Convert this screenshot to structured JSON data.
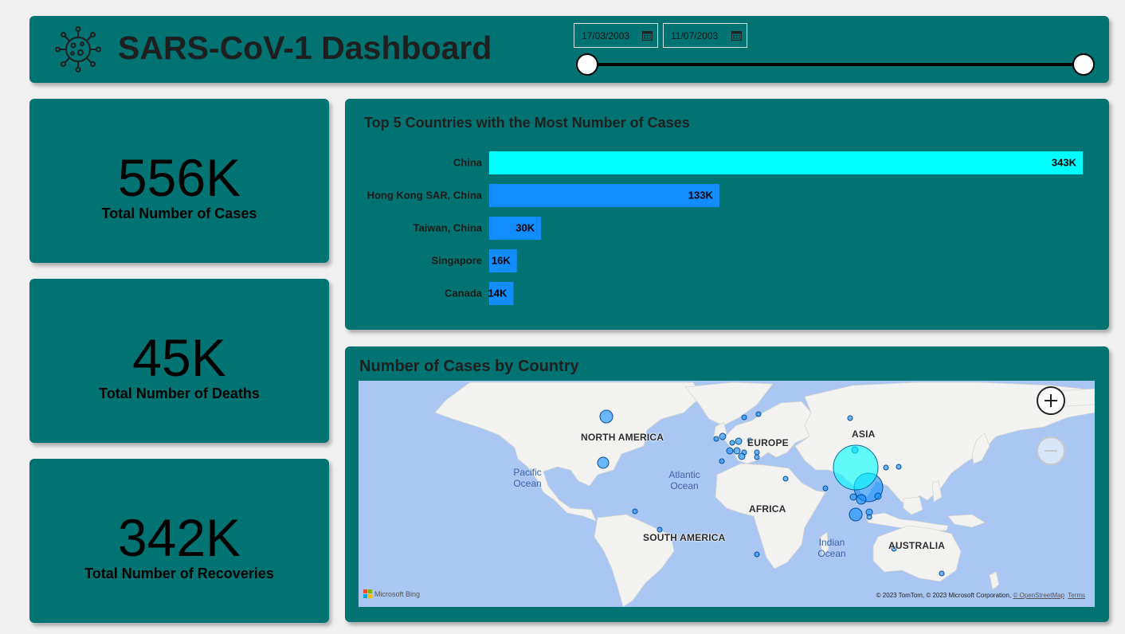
{
  "header": {
    "title": "SARS-CoV-1 Dashboard",
    "logo_icon": "virus-icon",
    "date_range": {
      "start": "17/03/2003",
      "end": "11/07/2003",
      "icon": "calendar-icon",
      "position": 1.0,
      "start_position": 0.0
    }
  },
  "kpis": {
    "cases": {
      "value": "556K",
      "label": "Total Number of Cases"
    },
    "deaths": {
      "value": "45K",
      "label": "Total Number of Deaths"
    },
    "recoveries": {
      "value": "342K",
      "label": "Total Number of Recoveries"
    }
  },
  "chart_data": {
    "type": "bar",
    "orientation": "horizontal",
    "title": "Top 5 Countries with the Most Number of Cases",
    "categories": [
      "China",
      "Hong Kong SAR, China",
      "Taiwan, China",
      "Singapore",
      "Canada"
    ],
    "values": [
      343,
      133,
      30,
      16,
      14
    ],
    "labels": [
      "343K",
      "133K",
      "30K",
      "16K",
      "14K"
    ],
    "unit": "K",
    "xlim": [
      0,
      343
    ],
    "grid": false,
    "colors": {
      "highlight": "#00ffff",
      "default": "#118dff"
    }
  },
  "map": {
    "title": "Number of Cases by Country",
    "continents": [
      "NORTH AMERICA",
      "EUROPE",
      "ASIA",
      "AFRICA",
      "SOUTH AMERICA",
      "AUSTRALIA"
    ],
    "oceans": [
      "Pacific Ocean",
      "Atlantic Ocean",
      "Indian Ocean"
    ],
    "provider": "Microsoft Bing",
    "attribution": "© 2023 TomTom, © 2023 Microsoft Corporation,",
    "osm_link": "© OpenStreetMap",
    "terms_link": "Terms",
    "zoom_in_icon": "plus-icon",
    "zoom_out_icon": "minus-icon",
    "colors": {
      "water": "#a9c7f2",
      "land": "#f2f2f0",
      "bubble": "#118dff",
      "bubble_highlight": "#00ffff"
    }
  }
}
